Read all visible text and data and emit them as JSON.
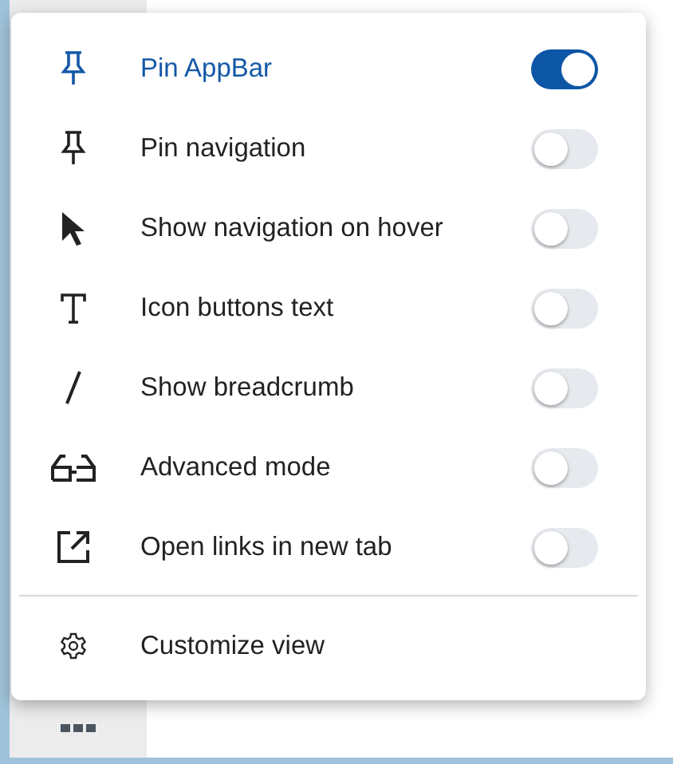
{
  "menu": {
    "items": [
      {
        "kind": "toggle",
        "label": "Pin AppBar",
        "on": true
      },
      {
        "kind": "toggle",
        "label": "Pin navigation",
        "on": false
      },
      {
        "kind": "toggle",
        "label": "Show navigation on hover",
        "on": false
      },
      {
        "kind": "toggle",
        "label": "Icon buttons text",
        "on": false
      },
      {
        "kind": "toggle",
        "label": "Show breadcrumb",
        "on": false
      },
      {
        "kind": "toggle",
        "label": "Advanced mode",
        "on": false
      },
      {
        "kind": "toggle",
        "label": "Open links in new tab",
        "on": false
      },
      {
        "kind": "action",
        "label": "Customize view"
      }
    ]
  }
}
